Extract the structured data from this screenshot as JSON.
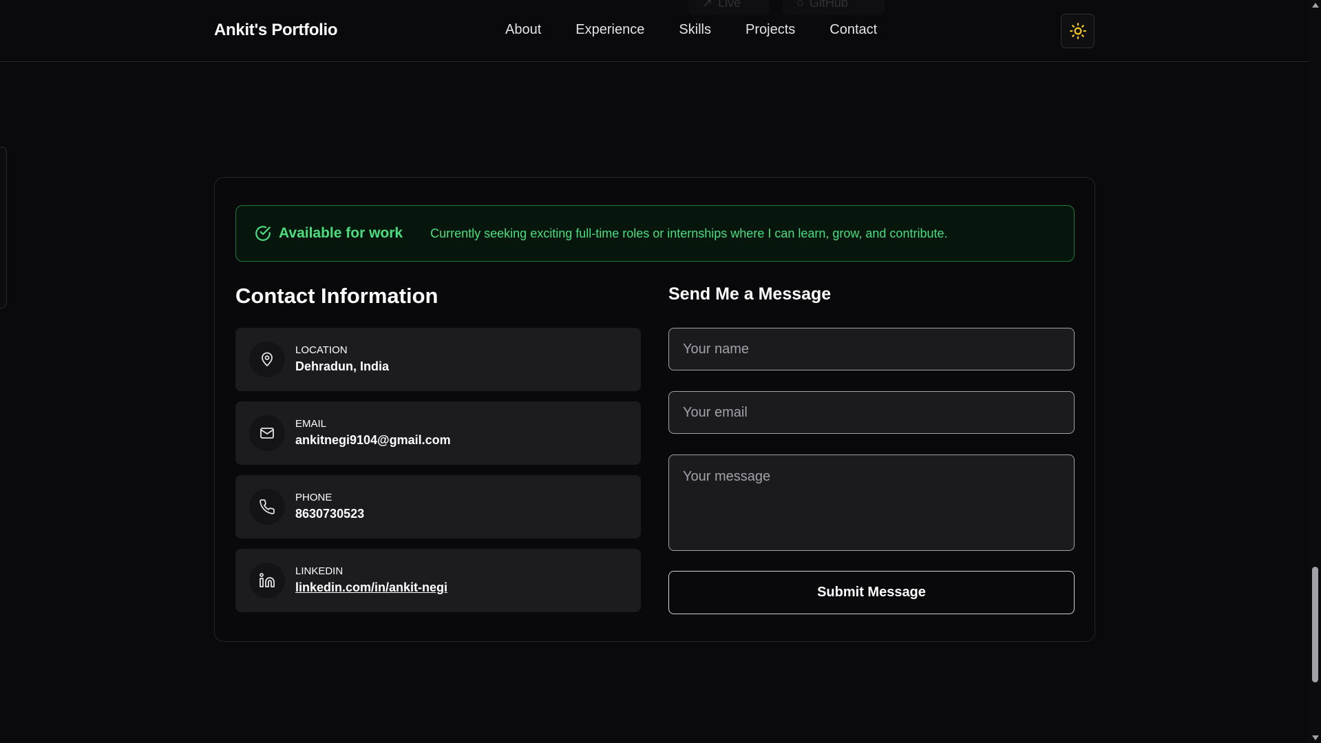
{
  "header": {
    "brand": "Ankit's Portfolio",
    "nav": [
      "About",
      "Experience",
      "Skills",
      "Projects",
      "Contact"
    ],
    "ghost_buttons": [
      "Live",
      "GitHub"
    ],
    "theme_icon": "sun-icon"
  },
  "availability": {
    "icon": "check-circle-icon",
    "title": "Available for work",
    "text": "Currently seeking exciting full-time roles or internships where I can learn, grow, and contribute.",
    "color": "#4ade80"
  },
  "contact_info": {
    "title": "Contact Information",
    "items": [
      {
        "icon": "map-pin-icon",
        "label": "LOCATION",
        "value": "Dehradun, India"
      },
      {
        "icon": "mail-icon",
        "label": "EMAIL",
        "value": "ankitnegi9104@gmail.com"
      },
      {
        "icon": "phone-icon",
        "label": "PHONE",
        "value": "8630730523"
      },
      {
        "icon": "linkedin-icon",
        "label": "LINKEDIN",
        "value": "linkedin.com/in/ankit-negi"
      }
    ]
  },
  "message_form": {
    "title": "Send Me a Message",
    "name_placeholder": "Your name",
    "email_placeholder": "Your email",
    "message_placeholder": "Your message",
    "submit_label": "Submit Message"
  },
  "colors": {
    "background": "#0a0a0c",
    "accent": "#4ade80",
    "card_item": "#1c1c1f",
    "theme_icon": "#facc15"
  }
}
